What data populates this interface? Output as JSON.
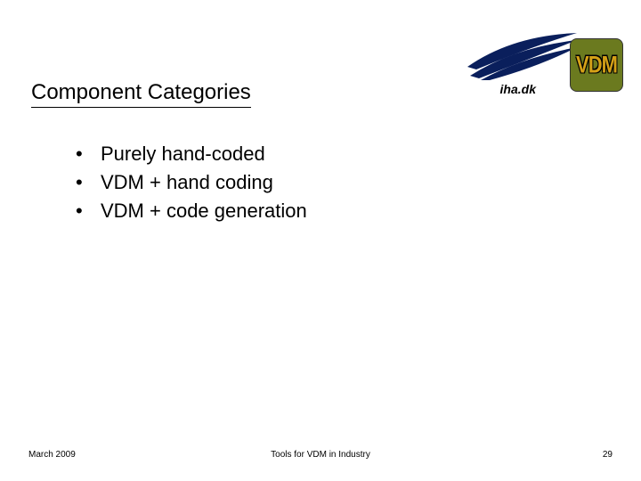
{
  "title": "Component Categories",
  "bullets": [
    "Purely hand-coded",
    "VDM + hand coding",
    "VDM + code generation"
  ],
  "footer": {
    "date": "March 2009",
    "center": "Tools for VDM in Industry",
    "page": "29"
  },
  "logos": {
    "iha_text": "iha.dk",
    "vdm_text": "VDM"
  }
}
